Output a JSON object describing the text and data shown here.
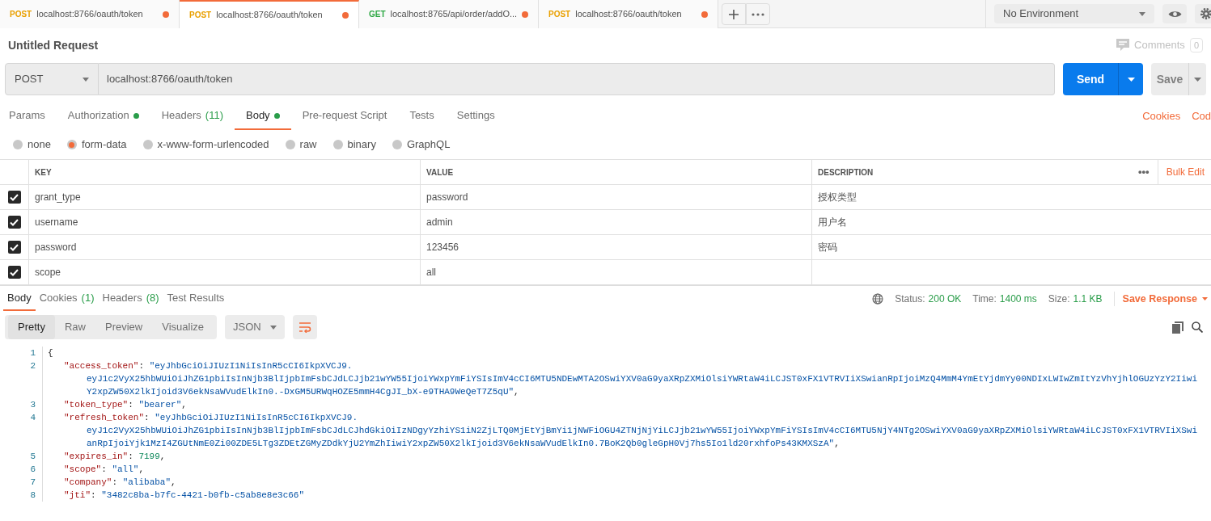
{
  "tabs": [
    {
      "method": "POST",
      "color": "#e9a000",
      "url": "localhost:8766/oauth/token",
      "unsaved": true,
      "selected": false
    },
    {
      "method": "POST",
      "color": "#e9a000",
      "url": "localhost:8766/oauth/token",
      "unsaved": true,
      "selected": true
    },
    {
      "method": "GET",
      "color": "#2fa845",
      "url": "localhost:8765/api/order/addO...",
      "unsaved": true,
      "selected": false
    },
    {
      "method": "POST",
      "color": "#e9a000",
      "url": "localhost:8766/oauth/token",
      "unsaved": true,
      "selected": false
    }
  ],
  "environment": {
    "label": "No Environment"
  },
  "request_title": "Untitled Request",
  "comments": {
    "label": "Comments",
    "count": "0"
  },
  "request": {
    "method": "POST",
    "url": "localhost:8766/oauth/token",
    "send": "Send",
    "save": "Save"
  },
  "request_tabs": [
    {
      "label": "Params",
      "selected": false
    },
    {
      "label": "Authorization",
      "indicator": true,
      "selected": false
    },
    {
      "label": "Headers",
      "count": "(11)",
      "selected": false
    },
    {
      "label": "Body",
      "indicator": true,
      "selected": true
    },
    {
      "label": "Pre-request Script",
      "selected": false
    },
    {
      "label": "Tests",
      "selected": false
    },
    {
      "label": "Settings",
      "selected": false
    }
  ],
  "request_links": [
    "Cookies",
    "Cod"
  ],
  "body_types": [
    {
      "label": "none",
      "selected": false
    },
    {
      "label": "form-data",
      "selected": true
    },
    {
      "label": "x-www-form-urlencoded",
      "selected": false
    },
    {
      "label": "raw",
      "selected": false
    },
    {
      "label": "binary",
      "selected": false
    },
    {
      "label": "GraphQL",
      "selected": false
    }
  ],
  "form_table": {
    "columns": [
      "KEY",
      "VALUE",
      "DESCRIPTION"
    ],
    "more": "•••",
    "bulk_edit": "Bulk Edit",
    "rows": [
      {
        "checked": true,
        "key": "grant_type",
        "value": "password",
        "description": "授权类型"
      },
      {
        "checked": true,
        "key": "username",
        "value": "admin",
        "description": "用户名"
      },
      {
        "checked": true,
        "key": "password",
        "value": "123456",
        "description": "密码"
      },
      {
        "checked": true,
        "key": "scope",
        "value": "all",
        "description": ""
      }
    ]
  },
  "response_tabs": [
    {
      "label": "Body",
      "selected": true
    },
    {
      "label": "Cookies",
      "count": "(1)",
      "selected": false
    },
    {
      "label": "Headers",
      "count": "(8)",
      "selected": false
    },
    {
      "label": "Test Results",
      "selected": false
    }
  ],
  "response_meta": [
    {
      "label": "Status:",
      "value": "200 OK"
    },
    {
      "label": "Time:",
      "value": "1400 ms"
    },
    {
      "label": "Size:",
      "value": "1.1 KB"
    }
  ],
  "save_response": "Save Response",
  "view_modes": [
    {
      "label": "Pretty",
      "selected": true
    },
    {
      "label": "Raw",
      "selected": false
    },
    {
      "label": "Preview",
      "selected": false
    },
    {
      "label": "Visualize",
      "selected": false
    }
  ],
  "format": "JSON",
  "code_rows": [
    {
      "kind": "line",
      "number": "1",
      "tokens": [
        {
          "kind": "punct",
          "text": "{"
        }
      ]
    },
    {
      "kind": "line",
      "number": "2",
      "tokens": [
        {
          "kind": "key",
          "text": "\"access_token\""
        },
        {
          "kind": "punct",
          "text": ": "
        },
        {
          "kind": "string",
          "text": "\"eyJhbGciOiJIUzI1NiIsInR5cCI6IkpXVCJ9."
        }
      ]
    },
    {
      "kind": "wrap",
      "tokens": [
        {
          "kind": "string",
          "text": "eyJ1c2VyX25hbWUiOiJhZG1pbiIsInNjb3BlIjpbImFsbCJdLCJjb21wYW55IjoiYWxpYmFiYSIsImV4cCI6MTU5NDEwMTA2OSwiYXV0aG9yaXRpZXMiOlsiYWRtaW4iLCJST0xFX1VTRVIiXSwianRpIjoiMzQ4MmM4YmEtYjdmYy00NDIxLWIwZmItYzVhYjhlOGUzYzY2Iiwi"
        }
      ]
    },
    {
      "kind": "wrap",
      "tokens": [
        {
          "kind": "string",
          "text": "Y2xpZW50X2lkIjoid3V6ekNsaWVudElkIn0.-DxGM5URWqHOZE5mmH4CgJI_bX-e9THA9WeQeT7Z5qU\""
        },
        {
          "kind": "punct",
          "text": ","
        }
      ]
    },
    {
      "kind": "line",
      "number": "3",
      "tokens": [
        {
          "kind": "key",
          "text": "\"token_type\""
        },
        {
          "kind": "punct",
          "text": ": "
        },
        {
          "kind": "string",
          "text": "\"bearer\""
        },
        {
          "kind": "punct",
          "text": ","
        }
      ]
    },
    {
      "kind": "line",
      "number": "4",
      "tokens": [
        {
          "kind": "key",
          "text": "\"refresh_token\""
        },
        {
          "kind": "punct",
          "text": ": "
        },
        {
          "kind": "string",
          "text": "\"eyJhbGciOiJIUzI1NiIsInR5cCI6IkpXVCJ9."
        }
      ]
    },
    {
      "kind": "wrap",
      "tokens": [
        {
          "kind": "string",
          "text": "eyJ1c2VyX25hbWUiOiJhZG1pbiIsInNjb3BlIjpbImFsbCJdLCJhdGkiOiIzNDgyYzhiYS1iN2ZjLTQ0MjEtYjBmYi1jNWFiOGU4ZTNjNjYiLCJjb21wYW55IjoiYWxpYmFiYSIsImV4cCI6MTU5NjY4NTg2OSwiYXV0aG9yaXRpZXMiOlsiYWRtaW4iLCJST0xFX1VTRVIiXSwi"
        }
      ]
    },
    {
      "kind": "wrap",
      "tokens": [
        {
          "kind": "string",
          "text": "anRpIjoiYjk1MzI4ZGUtNmE0Zi00ZDE5LTg3ZDEtZGMyZDdkYjU2YmZhIiwiY2xpZW50X2lkIjoid3V6ekNsaWVudElkIn0.7BoK2Qb0gleGpH0Vj7hs5Io1ld20rxhfoPs43KMXSzA\""
        },
        {
          "kind": "punct",
          "text": ","
        }
      ]
    },
    {
      "kind": "line",
      "number": "5",
      "tokens": [
        {
          "kind": "key",
          "text": "\"expires_in\""
        },
        {
          "kind": "punct",
          "text": ": "
        },
        {
          "kind": "number",
          "text": "7199"
        },
        {
          "kind": "punct",
          "text": ","
        }
      ]
    },
    {
      "kind": "line",
      "number": "6",
      "tokens": [
        {
          "kind": "key",
          "text": "\"scope\""
        },
        {
          "kind": "punct",
          "text": ": "
        },
        {
          "kind": "string",
          "text": "\"all\""
        },
        {
          "kind": "punct",
          "text": ","
        }
      ]
    },
    {
      "kind": "line",
      "number": "7",
      "tokens": [
        {
          "kind": "key",
          "text": "\"company\""
        },
        {
          "kind": "punct",
          "text": ": "
        },
        {
          "kind": "string",
          "text": "\"alibaba\""
        },
        {
          "kind": "punct",
          "text": ","
        }
      ]
    },
    {
      "kind": "line",
      "number": "8",
      "tokens": [
        {
          "kind": "key",
          "text": "\"jti\""
        },
        {
          "kind": "punct",
          "text": ": "
        },
        {
          "kind": "string",
          "text": "\"3482c8ba-b7fc-4421-b0fb-c5ab8e8e3c66\""
        }
      ]
    }
  ]
}
